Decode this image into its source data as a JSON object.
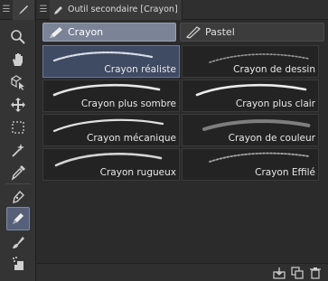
{
  "toolbar": {
    "tools": [
      {
        "icon": "zoom-icon",
        "active": false
      },
      {
        "icon": "hand-icon",
        "active": false
      },
      {
        "icon": "object-select-icon",
        "active": false
      },
      {
        "icon": "move-icon",
        "active": false
      },
      {
        "icon": "selection-marquee-icon",
        "active": false
      },
      {
        "icon": "magic-wand-icon",
        "active": false
      },
      {
        "icon": "eyedropper-icon",
        "active": false
      },
      {
        "icon": "pen-icon",
        "active": false
      },
      {
        "icon": "pencil-icon",
        "active": true
      },
      {
        "icon": "brush-icon",
        "active": false
      },
      {
        "icon": "airbrush-icon",
        "active": false
      }
    ]
  },
  "panel": {
    "tab_title": "Outil secondaire [Crayon]",
    "groups": [
      {
        "label": "Crayon",
        "active": true
      },
      {
        "label": "Pastel",
        "active": false
      }
    ],
    "items": [
      {
        "label": "Crayon réaliste",
        "selected": true
      },
      {
        "label": "Crayon de dessin",
        "selected": false
      },
      {
        "label": "Crayon plus sombre",
        "selected": false
      },
      {
        "label": "Crayon plus clair",
        "selected": false
      },
      {
        "label": "Crayon mécanique",
        "selected": false
      },
      {
        "label": "Crayon de couleur",
        "selected": false
      },
      {
        "label": "Crayon rugueux",
        "selected": false
      },
      {
        "label": "Crayon Effilé",
        "selected": false
      }
    ]
  },
  "colors": {
    "accent": "#7b8396",
    "selected_cell": "#3f4a63",
    "background": "#2b2b2b"
  }
}
